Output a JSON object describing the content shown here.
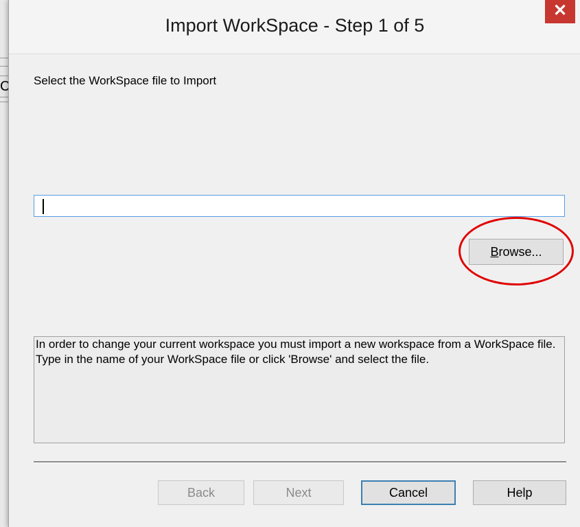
{
  "background_app": {
    "partial_letter": "C"
  },
  "dialog": {
    "title": "Import WorkSpace - Step 1 of 5",
    "close_symbol": "✕",
    "prompt": "Select the WorkSpace file to Import",
    "file_path_value": "",
    "browse_label": "rowse...",
    "browse_mnemonic": "B",
    "info_text": "In order to change your current workspace you must import a new workspace from a WorkSpace file. Type in the name of your WorkSpace file or click 'Browse' and select the file.",
    "buttons": {
      "back": "Back",
      "next": "Next",
      "cancel": "Cancel",
      "help": "Help"
    }
  },
  "colors": {
    "close_button": "#c7372f",
    "input_focus_border": "#569de5",
    "highlight_circle": "#e00000"
  }
}
